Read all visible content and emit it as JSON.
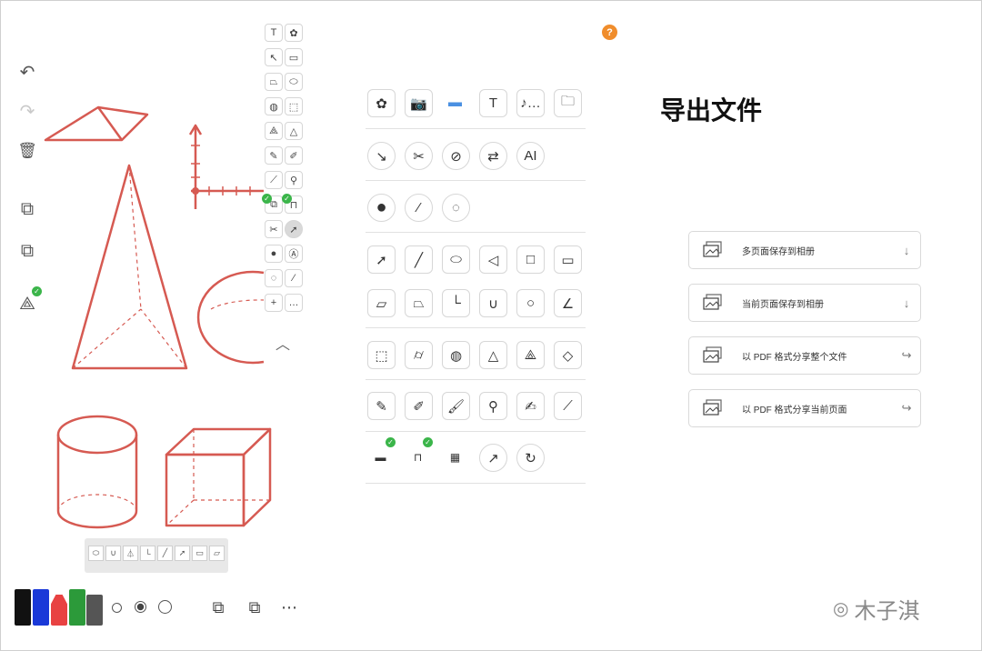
{
  "help_button": "?",
  "export_panel": {
    "title": "导出文件",
    "options": [
      {
        "label": "多页面保存到相册",
        "icon": "photo-stack-icon",
        "action_icon": "download-icon",
        "action": "↓"
      },
      {
        "label": "当前页面保存到相册",
        "icon": "photo-icon",
        "action_icon": "download-icon",
        "action": "↓"
      },
      {
        "label": "以 PDF 格式分享整个文件",
        "icon": "pages-stack-icon",
        "action_icon": "share-icon",
        "action": "↪"
      },
      {
        "label": "以 PDF 格式分享当前页面",
        "icon": "page-icon",
        "action_icon": "share-icon",
        "action": "↪"
      }
    ]
  },
  "tool_dock": {
    "row1": [
      {
        "glyph": "✿",
        "icon": "photos-icon"
      },
      {
        "glyph": "📷",
        "icon": "camera-icon"
      },
      {
        "glyph": "▬",
        "icon": "folder-blue-icon"
      },
      {
        "glyph": "T",
        "icon": "text-icon"
      },
      {
        "glyph": "♪…",
        "icon": "audio-icon"
      },
      {
        "glyph": "🗀",
        "icon": "folder-icon"
      }
    ],
    "row2": [
      {
        "glyph": "↘",
        "icon": "compass-icon"
      },
      {
        "glyph": "✂",
        "icon": "scissors-icon"
      },
      {
        "glyph": "⊘",
        "icon": "hide-icon"
      },
      {
        "glyph": "⇄",
        "icon": "swap-icon"
      },
      {
        "glyph": "AI",
        "icon": "ai-icon"
      }
    ],
    "row3": [
      {
        "glyph": "●",
        "icon": "fill-color-icon"
      },
      {
        "glyph": "⁄",
        "icon": "stroke-style-icon"
      },
      {
        "glyph": "◌",
        "icon": "color-picker-icon"
      }
    ],
    "row4": [
      {
        "glyph": "➚",
        "icon": "arrow-icon"
      },
      {
        "glyph": "╱",
        "icon": "line-icon"
      },
      {
        "glyph": "⬭",
        "icon": "ellipse-icon"
      },
      {
        "glyph": "◁",
        "icon": "triangle-icon"
      },
      {
        "glyph": "□",
        "icon": "square-icon"
      },
      {
        "glyph": "▭",
        "icon": "rectangle-icon"
      }
    ],
    "row5": [
      {
        "glyph": "▱",
        "icon": "parallelogram-icon"
      },
      {
        "glyph": "⏢",
        "icon": "trapezoid-icon"
      },
      {
        "glyph": "└",
        "icon": "axes-icon"
      },
      {
        "glyph": "∪",
        "icon": "parabola-icon"
      },
      {
        "glyph": "○",
        "icon": "circle-icon"
      },
      {
        "glyph": "∠",
        "icon": "angle-icon"
      }
    ],
    "row6": [
      {
        "glyph": "⬚",
        "icon": "cube-icon"
      },
      {
        "glyph": "⌭",
        "icon": "cylinder-icon"
      },
      {
        "glyph": "◍",
        "icon": "sphere-icon"
      },
      {
        "glyph": "△",
        "icon": "cone-icon"
      },
      {
        "glyph": "⟁",
        "icon": "pyramid-icon"
      },
      {
        "glyph": "◇",
        "icon": "square-pyramid-icon"
      }
    ],
    "row7": [
      {
        "glyph": "✎",
        "icon": "pencil-icon"
      },
      {
        "glyph": "✐",
        "icon": "marker-icon"
      },
      {
        "glyph": "🖌",
        "icon": "brush-icon"
      },
      {
        "glyph": "⚲",
        "icon": "fountain-brush-icon"
      },
      {
        "glyph": "✍",
        "icon": "highlighter-icon"
      },
      {
        "glyph": "⟋",
        "icon": "pen-nib-icon"
      }
    ],
    "row8": [
      {
        "glyph": "▬",
        "icon": "waterline-icon"
      },
      {
        "glyph": "⊓",
        "icon": "magnet-icon"
      },
      {
        "glyph": "▦",
        "icon": "palette-icon"
      },
      {
        "glyph": "↗",
        "icon": "rotate-icon"
      },
      {
        "glyph": "↻",
        "icon": "refresh-icon"
      }
    ]
  },
  "small_palette": {
    "rows": [
      [
        "T",
        "✿"
      ],
      [
        "↖",
        "▭"
      ],
      [
        "⏢",
        "⬭"
      ],
      [
        "◍",
        "⬚"
      ],
      [
        "⟁",
        "△"
      ],
      [
        "✎",
        "✐"
      ],
      [
        "⟋",
        "⚲"
      ],
      [
        "⧉",
        "⊓"
      ],
      [
        "✂",
        "➚"
      ],
      [
        "●",
        "Ⓐ"
      ],
      [
        "◌",
        "⁄"
      ],
      [
        "+",
        "…"
      ]
    ],
    "collapse": "︿"
  },
  "left_toolbar": {
    "undo": "↶",
    "redo": "↷",
    "delete": "🗑",
    "copy": "⧉",
    "paste": "⧉",
    "shape": "⟁"
  },
  "bottom_bar": {
    "pens": [
      "#111111",
      "#1a39d8",
      "#e84242",
      "#2c9a3a",
      "#555555"
    ],
    "more": "⋯"
  },
  "watermark": "木子淇"
}
